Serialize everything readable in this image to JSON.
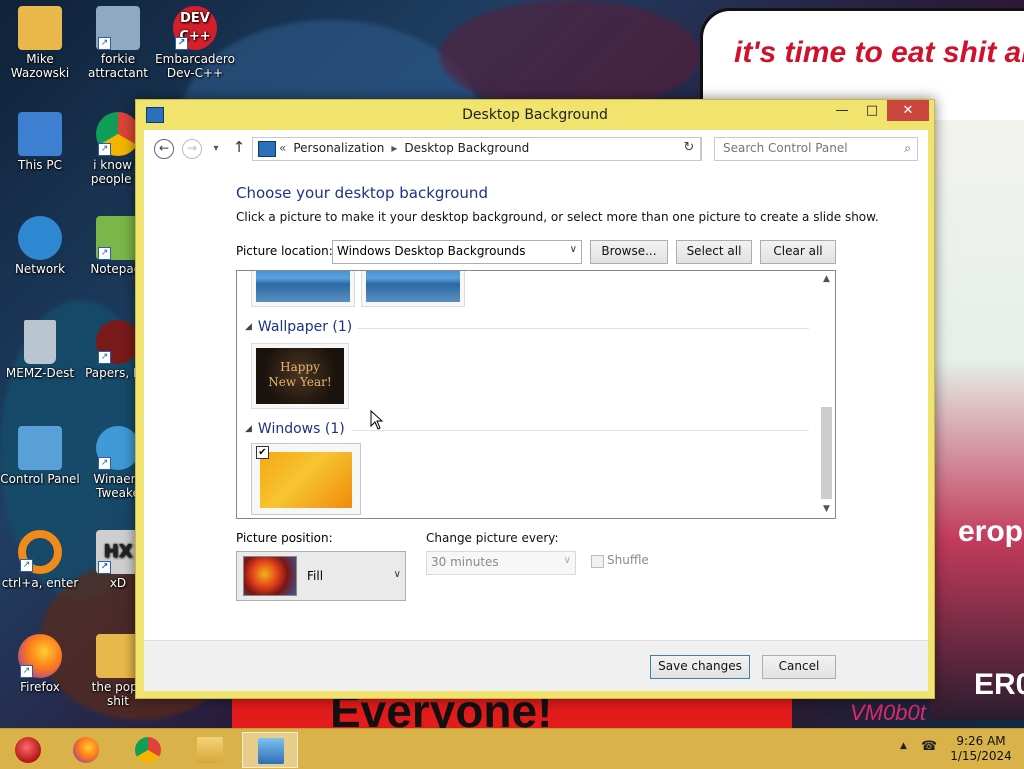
{
  "wallpaper": {
    "poster_text": "it's time to eat shit and die andcelebra",
    "bottom_sign": "Everyone!",
    "right_text_1": "erop",
    "right_text_2": "ER0",
    "corner_text": "VM0b0t"
  },
  "desktop_icons": [
    {
      "name": "desktop-icon-mike",
      "line1": "Mike",
      "line2": "Wazowski",
      "icon": "folder-user-icon",
      "color": "#e8b94a"
    },
    {
      "name": "desktop-icon-forkie",
      "line1": "forkie",
      "line2": "attractant",
      "icon": "settings-computer-icon",
      "color": "#8fa9c2"
    },
    {
      "name": "desktop-icon-devcpp",
      "line1": "Embarcadero",
      "line2": "Dev-C++",
      "icon": "devcpp-icon",
      "color": "#d51f2a",
      "badge": "DEV C++"
    },
    {
      "name": "desktop-icon-thispc",
      "line1": "This PC",
      "line2": "",
      "icon": "computer-icon",
      "color": "#3d7fd0"
    },
    {
      "name": "desktop-icon-chrome",
      "line1": "i know y",
      "line2": "people w",
      "icon": "chrome-icon",
      "color": "#3a9a3f"
    },
    {
      "name": "desktop-icon-network",
      "line1": "Network",
      "line2": "",
      "icon": "network-globe-icon",
      "color": "#2f86d1"
    },
    {
      "name": "desktop-icon-notepad",
      "line1": "Notepad-",
      "line2": "",
      "icon": "notepad-plus-icon",
      "color": "#7ab648"
    },
    {
      "name": "desktop-icon-memz",
      "line1": "MEMZ-Dest",
      "line2": "",
      "icon": "recycle-bin-icon",
      "color": "#b9c6cf"
    },
    {
      "name": "desktop-icon-papers",
      "line1": "Papers, Ple",
      "line2": "",
      "icon": "papers-please-icon",
      "color": "#7a1a1a"
    },
    {
      "name": "desktop-icon-controlpanel",
      "line1": "Control Panel",
      "line2": "",
      "icon": "control-panel-icon",
      "color": "#5aa0d8"
    },
    {
      "name": "desktop-icon-winaero",
      "line1": "Winaero",
      "line2": "Tweake",
      "icon": "winaero-icon",
      "color": "#3f9ad6"
    },
    {
      "name": "desktop-icon-ctrl-a",
      "line1": "ctrl+a, enter",
      "line2": "",
      "icon": "ring-icon",
      "color": "#f08a1a"
    },
    {
      "name": "desktop-icon-xd",
      "line1": "xD",
      "line2": "",
      "icon": "hxd-icon",
      "color": "#cfcfcf"
    },
    {
      "name": "desktop-icon-firefox",
      "line1": "Firefox",
      "line2": "",
      "icon": "firefox-icon",
      "color": "#e8662a"
    },
    {
      "name": "desktop-icon-popcorn",
      "line1": "the popc",
      "line2": "shit",
      "icon": "folder-icon",
      "color": "#e8b94a"
    }
  ],
  "window": {
    "title": "Desktop Background",
    "minimize": "—",
    "maximize": "□",
    "close": "✕"
  },
  "nav": {
    "back": "←",
    "forward": "→",
    "history": "▾",
    "up": "↑",
    "crumb_overflow": "«",
    "breadcrumb": [
      "Personalization",
      "Desktop Background"
    ],
    "crumb_sep": "▸",
    "addr_dropdown": "∨",
    "refresh": "↻",
    "search_placeholder": "Search Control Panel",
    "search_icon": "⌕"
  },
  "content": {
    "title": "Choose your desktop background",
    "description": "Click a picture to make it your desktop background, or select more than one picture to create a slide show.",
    "location_label": "Picture location:",
    "location_value": "Windows Desktop Backgrounds",
    "dropdown_arrow": "∨",
    "browse": "Browse...",
    "select_all": "Select all",
    "clear_all": "Clear all"
  },
  "picture_groups": [
    {
      "name": "Wallpaper (1)",
      "items": [
        {
          "caption": "Happy New Year!",
          "checked": false
        }
      ]
    },
    {
      "name": "Windows (1)",
      "items": [
        {
          "caption": "",
          "checked": true
        }
      ]
    }
  ],
  "group_toggle": "◢",
  "check_mark": "✔",
  "scroll": {
    "up": "▲",
    "down": "▼"
  },
  "position": {
    "label": "Picture position:",
    "value": "Fill"
  },
  "change": {
    "label": "Change picture every:",
    "value": "30 minutes",
    "shuffle": "Shuffle",
    "shuffle_checked": false
  },
  "footer": {
    "save": "Save changes",
    "cancel": "Cancel"
  },
  "taskbar": {
    "items": [
      "start-orb",
      "firefox",
      "chrome",
      "file-explorer",
      "control-panel"
    ],
    "tray_arrow": "▲",
    "network_icon": "☎",
    "time": "9:26 AM",
    "date": "1/15/2024"
  }
}
